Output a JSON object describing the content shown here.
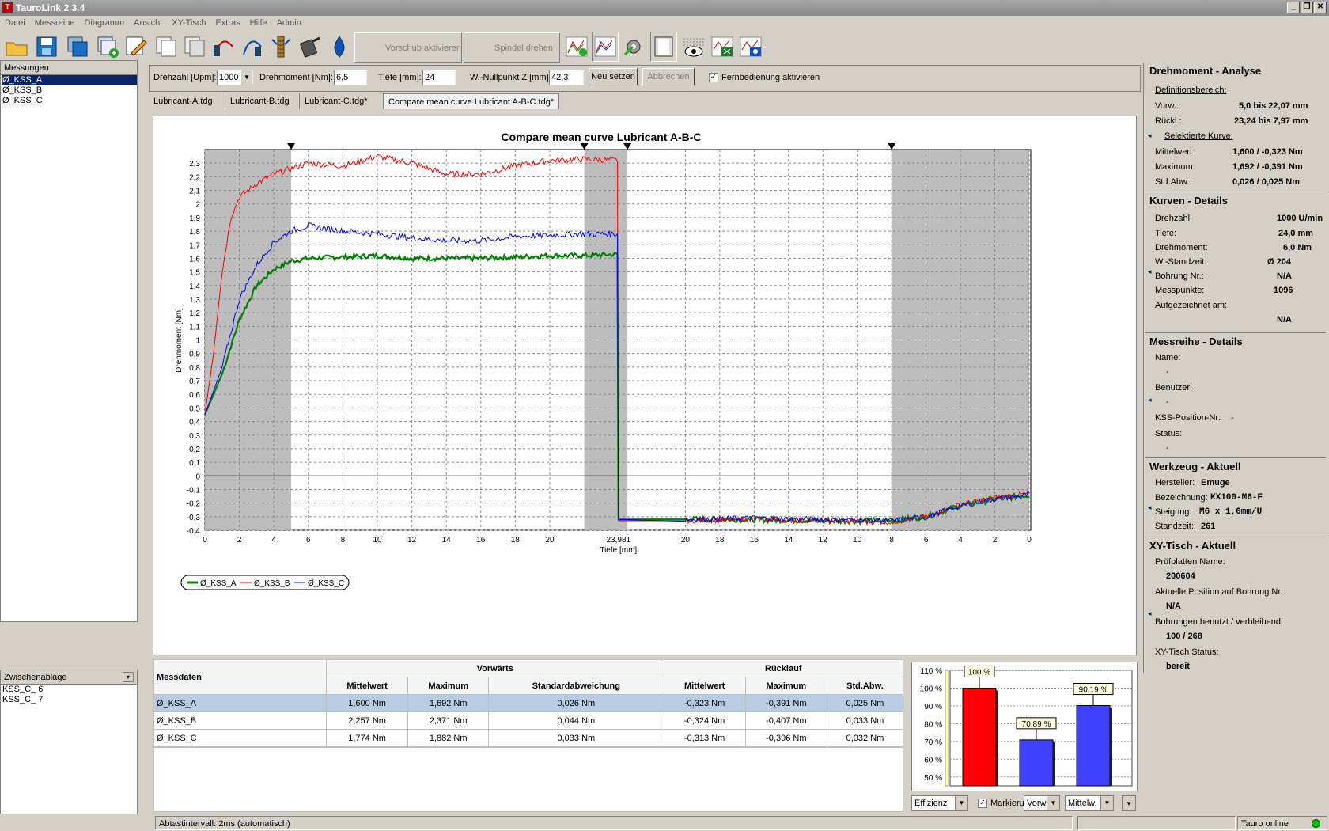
{
  "app": {
    "title": "TauroLink 2.3.4"
  },
  "menu": [
    "Datei",
    "Messreihe",
    "Diagramm",
    "Ansicht",
    "XY-Tisch",
    "Extras",
    "Hilfe",
    "Admin"
  ],
  "toolbar": {
    "vorschub_label": "Vorschub aktivieren",
    "spindel_label": "Spindel drehen"
  },
  "left": {
    "measurements_header": "Messungen",
    "measurements": [
      "Ø_KSS_A",
      "Ø_KSS_B",
      "Ø_KSS_C"
    ],
    "clipboard_header": "Zwischenablage",
    "clipboard": [
      "KSS_C_ 6",
      "KSS_C_ 7"
    ]
  },
  "params": {
    "drehzahl_label": "Drehzahl [Upm]:",
    "drehzahl_value": "1000",
    "drehmoment_label": "Drehmoment [Nm]:",
    "drehmoment_value": "6,5",
    "tiefe_label": "Tiefe [mm]:",
    "tiefe_value": "24",
    "nullpunkt_label": "W.-Nullpunkt Z [mm]:",
    "nullpunkt_value": "42,3",
    "neu_setzen": "Neu setzen",
    "abbrechen": "Abbrechen",
    "fern_label": "Fernbedienung aktivieren"
  },
  "tabs": [
    "Lubricant-A.tdg",
    "Lubricant-B.tdg",
    "Lubricant-C.tdg*",
    "Compare mean curve Lubricant A-B-C.tdg*"
  ],
  "chart_data": {
    "type": "line",
    "title": "Compare mean curve Lubricant A-B-C",
    "xlabel": "Tiefe [mm]",
    "ylabel": "Drehmoment [Nm]",
    "ylim": [
      -0.4,
      2.4
    ],
    "ytick_labels": [
      "2,3",
      "2,2",
      "2,1",
      "2",
      "1,9",
      "1,8",
      "1,7",
      "1,6",
      "1,5",
      "1,4",
      "1,3",
      "1,2",
      "1,1",
      "1",
      "0,9",
      "0,8",
      "0,7",
      "0,6",
      "0,5",
      "0,4",
      "0,3",
      "0,2",
      "0,1",
      "0",
      "-0,1",
      "-0,2",
      "-0,3",
      "-0,4"
    ],
    "xtick_labels_forward": [
      "0",
      "2",
      "4",
      "6",
      "8",
      "10",
      "12",
      "14",
      "16",
      "18",
      "20"
    ],
    "xtick_labels_reverse": [
      "20",
      "18",
      "16",
      "14",
      "12",
      "10",
      "8",
      "6",
      "4",
      "2",
      "0"
    ],
    "reversal_label": "23,981",
    "forward_max_depth": 23.981,
    "grid": true,
    "legend_position": "bottom-left",
    "shaded_ranges": {
      "forward": [
        [
          0,
          5
        ],
        [
          22,
          24.5
        ]
      ],
      "reverse": [
        [
          8,
          0
        ]
      ]
    },
    "markers_depth": {
      "forward": [
        5,
        22,
        24.5
      ],
      "reverse": [
        8
      ]
    },
    "series": [
      {
        "name": "Ø_KSS_A",
        "color": "#008000",
        "forward": [
          [
            0,
            0.45
          ],
          [
            1,
            0.75
          ],
          [
            2,
            1.15
          ],
          [
            3,
            1.4
          ],
          [
            4,
            1.52
          ],
          [
            5,
            1.58
          ],
          [
            6,
            1.6
          ],
          [
            8,
            1.61
          ],
          [
            10,
            1.62
          ],
          [
            12,
            1.6
          ],
          [
            14,
            1.6
          ],
          [
            16,
            1.6
          ],
          [
            18,
            1.61
          ],
          [
            20,
            1.62
          ],
          [
            22,
            1.62
          ],
          [
            23.98,
            1.63
          ]
        ],
        "reverse": [
          [
            20,
            -0.32
          ],
          [
            16,
            -0.32
          ],
          [
            12,
            -0.33
          ],
          [
            8,
            -0.33
          ],
          [
            6,
            -0.3
          ],
          [
            4,
            -0.22
          ],
          [
            2,
            -0.17
          ],
          [
            0,
            -0.14
          ]
        ]
      },
      {
        "name": "Ø_KSS_B",
        "color": "#ff0000",
        "forward": [
          [
            0,
            0.45
          ],
          [
            0.5,
            0.9
          ],
          [
            1,
            1.5
          ],
          [
            1.5,
            1.9
          ],
          [
            2,
            2.05
          ],
          [
            3,
            2.15
          ],
          [
            4,
            2.22
          ],
          [
            5,
            2.26
          ],
          [
            6,
            2.3
          ],
          [
            8,
            2.28
          ],
          [
            10,
            2.35
          ],
          [
            12,
            2.3
          ],
          [
            14,
            2.22
          ],
          [
            16,
            2.22
          ],
          [
            18,
            2.28
          ],
          [
            20,
            2.32
          ],
          [
            22,
            2.33
          ],
          [
            23.98,
            2.32
          ]
        ],
        "reverse": [
          [
            20,
            -0.33
          ],
          [
            16,
            -0.32
          ],
          [
            12,
            -0.33
          ],
          [
            8,
            -0.34
          ],
          [
            6,
            -0.3
          ],
          [
            4,
            -0.21
          ],
          [
            2,
            -0.16
          ],
          [
            0,
            -0.13
          ]
        ]
      },
      {
        "name": "Ø_KSS_C",
        "color": "#0000ff",
        "forward": [
          [
            0,
            0.45
          ],
          [
            1,
            0.8
          ],
          [
            2,
            1.3
          ],
          [
            3,
            1.55
          ],
          [
            4,
            1.72
          ],
          [
            5,
            1.8
          ],
          [
            6,
            1.84
          ],
          [
            8,
            1.8
          ],
          [
            10,
            1.78
          ],
          [
            12,
            1.75
          ],
          [
            14,
            1.73
          ],
          [
            16,
            1.73
          ],
          [
            18,
            1.76
          ],
          [
            20,
            1.77
          ],
          [
            22,
            1.78
          ],
          [
            23.98,
            1.78
          ]
        ],
        "reverse": [
          [
            20,
            -0.32
          ],
          [
            16,
            -0.31
          ],
          [
            12,
            -0.32
          ],
          [
            8,
            -0.33
          ],
          [
            6,
            -0.3
          ],
          [
            4,
            -0.22
          ],
          [
            2,
            -0.17
          ],
          [
            0,
            -0.14
          ]
        ]
      }
    ]
  },
  "messdaten": {
    "title": "Messdaten",
    "group_forward": "Vorwärts",
    "group_reverse": "Rücklauf",
    "columns": [
      "Mittelwert",
      "Maximum",
      "Standardabweichung",
      "Mittelwert",
      "Maximum",
      "Std.Abw."
    ],
    "rows": [
      {
        "name": "Ø_KSS_A",
        "values": [
          "1,600 Nm",
          "1,692 Nm",
          "0,026 Nm",
          "-0,323 Nm",
          "-0,391 Nm",
          "0,025 Nm"
        ]
      },
      {
        "name": "Ø_KSS_B",
        "values": [
          "2,257 Nm",
          "2,371 Nm",
          "0,044 Nm",
          "-0,324 Nm",
          "-0,407 Nm",
          "0,033 Nm"
        ]
      },
      {
        "name": "Ø_KSS_C",
        "values": [
          "1,774 Nm",
          "1,882 Nm",
          "0,033 Nm",
          "-0,313 Nm",
          "-0,396 Nm",
          "0,032 Nm"
        ]
      }
    ]
  },
  "efficiency_chart": {
    "type": "bar",
    "ytick_labels": [
      "110 %",
      "100 %",
      "90 %",
      "80 %",
      "70 %",
      "60 %",
      "50 %"
    ],
    "ylim": [
      45,
      110
    ],
    "bars": [
      {
        "label": "100 %",
        "value": 100,
        "color": "#ff0000"
      },
      {
        "label": "70,89 %",
        "value": 70.89,
        "color": "#4040ff"
      },
      {
        "label": "90,19 %",
        "value": 90.19,
        "color": "#4040ff"
      }
    ],
    "combo_effizienz": "Effizienz",
    "marker_label": "Markieru",
    "combo_vorw": "Vorw.",
    "combo_mittelw": "Mittelw."
  },
  "right": {
    "analyse_title": "Drehmoment - Analyse",
    "definitionsbereich": "Definitionsbereich:",
    "vorw_label": "Vorw.:",
    "vorw_value": "5,0 bis 22,07 mm",
    "rueckl_label": "Rückl.:",
    "rueckl_value": "23,24 bis 7,97 mm",
    "selektierte": "Selektierte Kurve:",
    "mittelwert_label": "Mittelwert:",
    "mittelwert_value": "1,600 / -0,323 Nm",
    "maximum_label": "Maximum:",
    "maximum_value": "1,692 / -0,391 Nm",
    "stdabw_label": "Std.Abw.:",
    "stdabw_value": "0,026 / 0,025 Nm",
    "kurven_title": "Kurven - Details",
    "k_drehzahl_label": "Drehzahl:",
    "k_drehzahl_value": "1000  U/min",
    "k_tiefe_label": "Tiefe:",
    "k_tiefe_value": "24,0  mm",
    "k_drehmoment_label": "Drehmoment:",
    "k_drehmoment_value": "6,0  Nm",
    "k_standzeit_label": "W.-Standzeit:",
    "k_standzeit_value": "Ø 204",
    "k_bohrung_label": "Bohrung Nr.:",
    "k_bohrung_value": "N/A",
    "k_messpunkte_label": "Messpunkte:",
    "k_messpunkte_value": "1096",
    "k_aufgezeichnet_label": "Aufgezeichnet am:",
    "k_aufgezeichnet_value": "N/A",
    "messreihe_title": "Messreihe - Details",
    "m_name_label": "Name:",
    "m_name_value": "-",
    "m_benutzer_label": "Benutzer:",
    "m_benutzer_value": "-",
    "m_kss_label": "KSS-Position-Nr:",
    "m_kss_value": "-",
    "m_status_label": "Status:",
    "m_status_value": "-",
    "werkzeug_title": "Werkzeug - Aktuell",
    "w_hersteller_label": "Hersteller:",
    "w_hersteller_value": "Emuge",
    "w_bezeichnung_label": "Bezeichnung:",
    "w_bezeichnung_value": "KX100-M6-F",
    "w_steigung_label": "Steigung:",
    "w_steigung_value": "M6 x 1,0mm/U",
    "w_standzeit_label": "Standzeit:",
    "w_standzeit_value": "261",
    "xy_title": "XY-Tisch - Aktuell",
    "x_pruef_label": "Prüfplatten Name:",
    "x_pruef_value": "200604",
    "x_pos_label": "Aktuelle Position auf Bohrung Nr.:",
    "x_pos_value": "N/A",
    "x_bohr_label": "Bohrungen benutzt / verbleibend:",
    "x_bohr_value": "100 / 268",
    "x_status_label": "XY-Tisch Status:",
    "x_status_value": "bereit"
  },
  "status": {
    "interval": "Abtastintervall: 2ms (automatisch)",
    "online": "Tauro online",
    "online_color": "#00c000"
  }
}
